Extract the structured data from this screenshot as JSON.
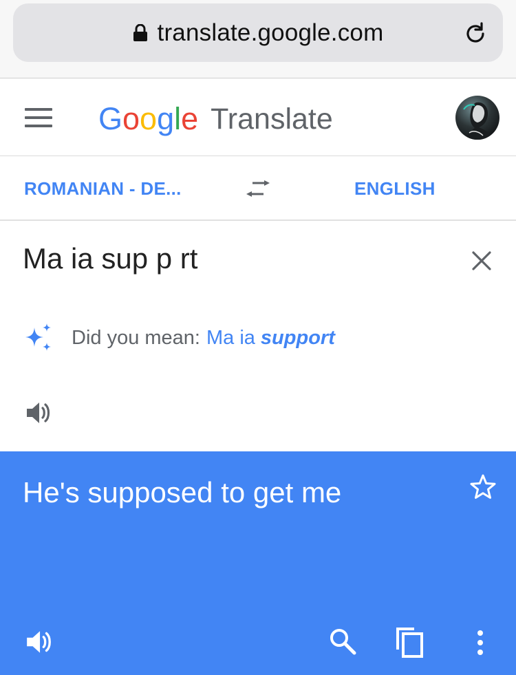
{
  "browser": {
    "url": "translate.google.com"
  },
  "header": {
    "logo_letters": [
      "G",
      "o",
      "o",
      "g",
      "l",
      "e"
    ],
    "logo_colors": [
      "#4285f4",
      "#ea4335",
      "#fbbc05",
      "#4285f4",
      "#34a853",
      "#ea4335"
    ],
    "title": "Translate"
  },
  "languages": {
    "source": "ROMANIAN - DE...",
    "target": "ENGLISH"
  },
  "source": {
    "text": "Ma ia sup p rt",
    "suggestion_label": "Did you mean:",
    "suggestion_prefix": "Ma ia",
    "suggestion_correction": "support"
  },
  "result": {
    "text": "He's supposed to get me"
  },
  "colors": {
    "accent": "#4285f4",
    "icon_gray": "#5f6368"
  },
  "icons": [
    "lock-icon",
    "reload-icon",
    "menu-icon",
    "swap-icon",
    "close-icon",
    "sparkle-icon",
    "speaker-icon",
    "star-icon",
    "search-icon",
    "copy-icon",
    "more-vert-icon"
  ]
}
